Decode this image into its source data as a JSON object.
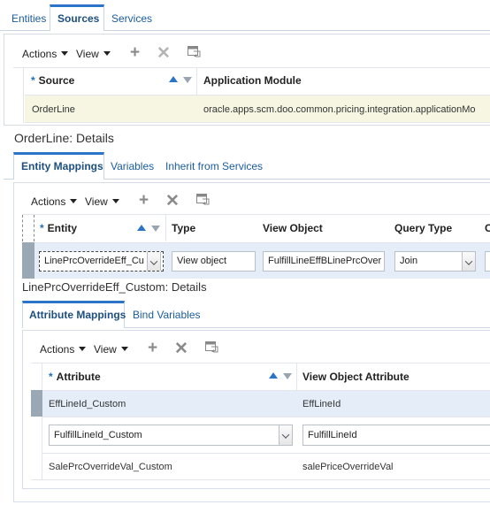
{
  "top_tabs": [
    "Entities",
    "Sources",
    "Services"
  ],
  "toolbar": {
    "actions": "Actions",
    "view": "View"
  },
  "sources_table": {
    "col_source": "Source",
    "col_app_module": "Application Module",
    "row": {
      "source": "OrderLine",
      "app_module": "oracle.apps.scm.doo.common.pricing.integration.applicationMo"
    }
  },
  "orderline_details": {
    "title": "OrderLine: Details",
    "tabs": [
      "Entity Mappings",
      "Variables",
      "Inherit from Services"
    ],
    "table": {
      "col_entity": "Entity",
      "col_type": "Type",
      "col_view_object": "View Object",
      "col_query_type": "Query Type",
      "col_cut": "C",
      "row": {
        "entity": "LinePrcOverrideEff_Cu",
        "type": "View object",
        "view_object": "FulfillLineEffBLinePrcOver",
        "query_type": "Join"
      }
    }
  },
  "entity_details": {
    "title": "LinePrcOverrideEff_Custom: Details",
    "tabs": [
      "Attribute Mappings",
      "Bind Variables"
    ],
    "table": {
      "col_attribute": "Attribute",
      "col_vo_attribute": "View Object Attribute",
      "rows": [
        {
          "attribute": "EffLineId_Custom",
          "vo_attribute": "EffLineId"
        },
        {
          "attribute": "FulfillLineId_Custom",
          "vo_attribute": "FulfillLineId"
        },
        {
          "attribute": "SalePrcOverrideVal_Custom",
          "vo_attribute": "salePriceOverrideVal"
        }
      ]
    }
  },
  "colors": {
    "accent": "#1a5c9e",
    "selected_row": "#e5eef8",
    "highlight_row": "#f6f6e3",
    "required_star": "#1f6fbf"
  },
  "icons": [
    "plus-icon",
    "delete-icon",
    "detach-icon",
    "sort-ascending-icon",
    "sort-descending-icon",
    "dropdown-icon"
  ]
}
